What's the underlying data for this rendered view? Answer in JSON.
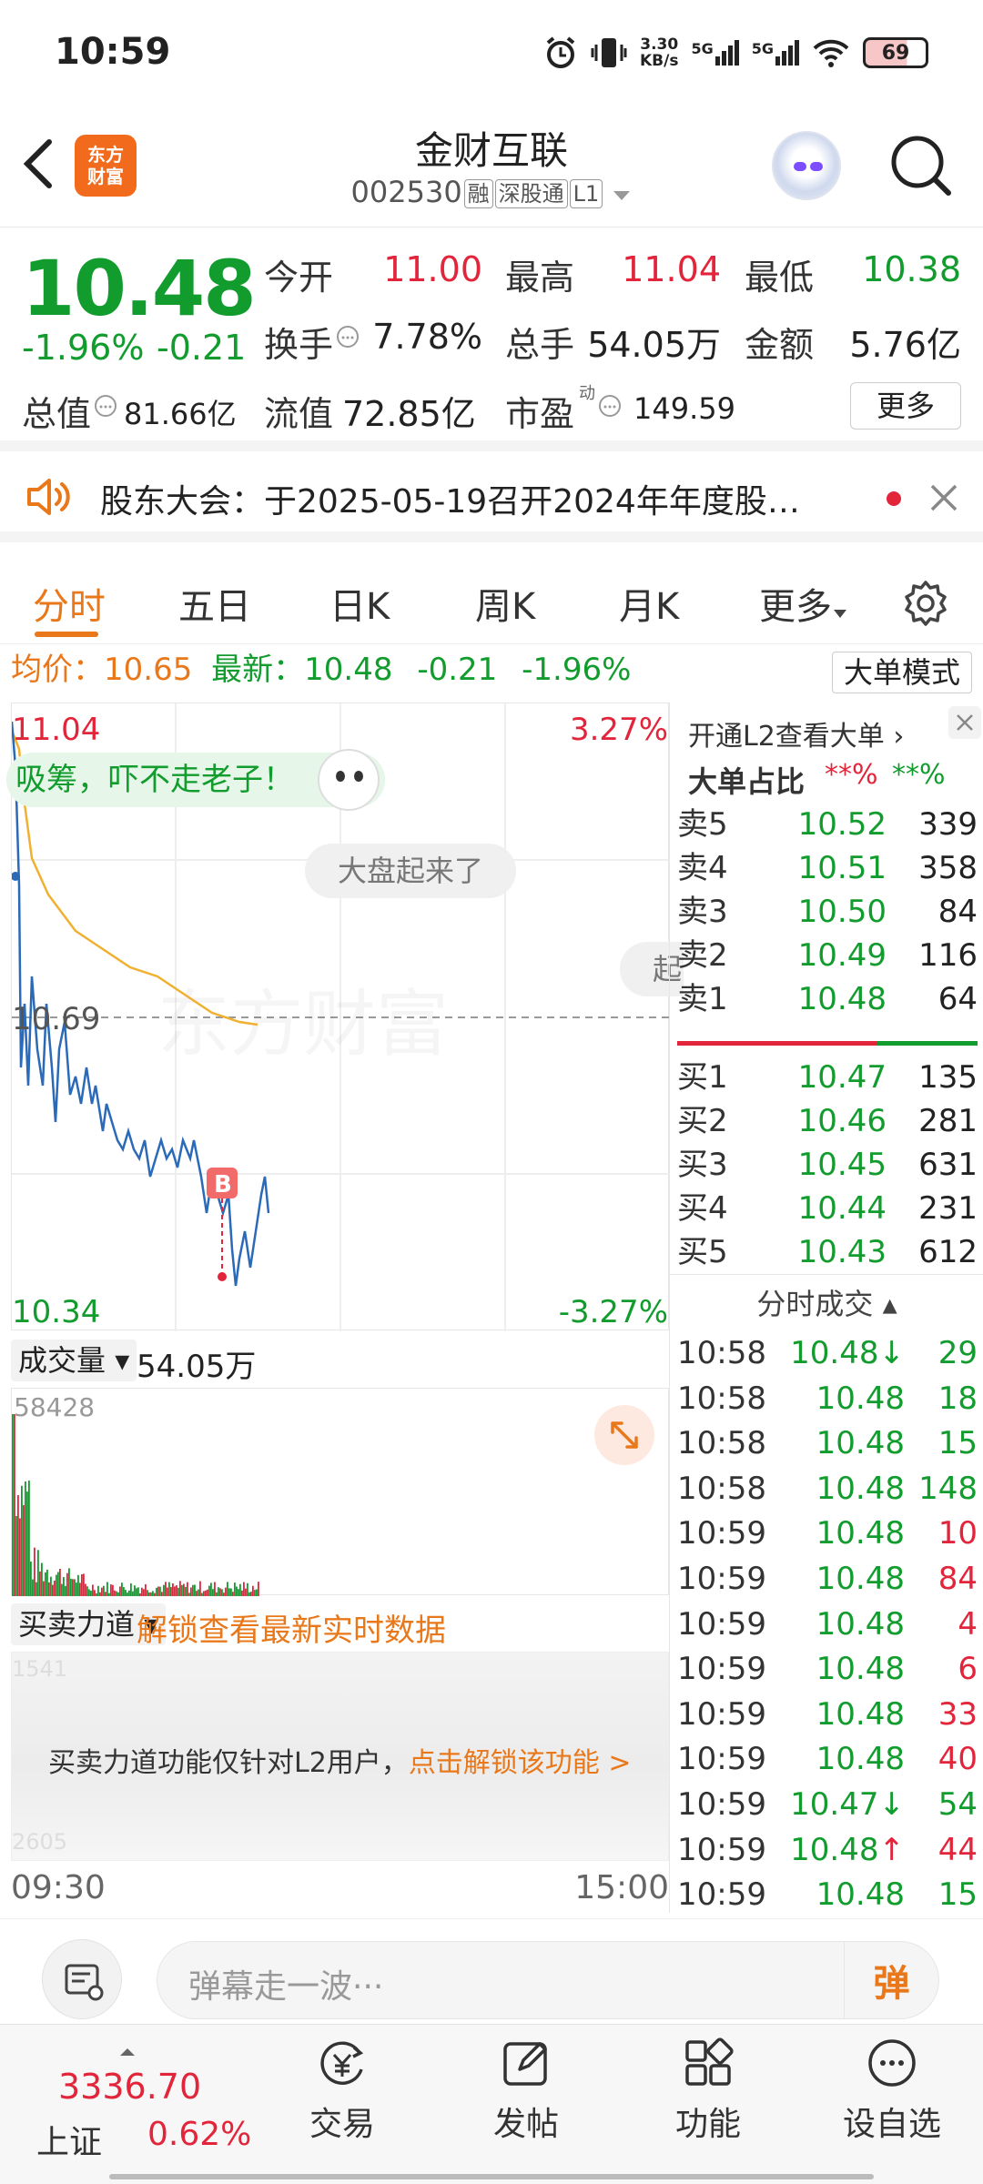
{
  "status_bar": {
    "time": "10:59",
    "net_speed_top": "3.30",
    "net_speed_unit": "KB/s",
    "sig1": "5G",
    "sig2": "5G",
    "battery": "69"
  },
  "header": {
    "logo_line1": "东方",
    "logo_line2": "财富",
    "stock_name": "金财互联",
    "code": "002530",
    "tag_margin": "融",
    "tag_connect": "深股通",
    "tag_level": "L1"
  },
  "quote": {
    "price": "10.48",
    "change_pct": "-1.96%",
    "change_val": "-0.21",
    "open_label": "今开",
    "open": "11.00",
    "high_label": "最高",
    "high": "11.04",
    "low_label": "最低",
    "low": "10.38",
    "turnover_label": "换手",
    "turnover": "7.78%",
    "volume_label": "总手",
    "volume": "54.05万",
    "amount_label": "金额",
    "amount": "5.76亿",
    "mktcap_label": "总值",
    "mktcap": "81.66亿",
    "float_label": "流值",
    "float_val": "72.85亿",
    "pe_label": "市盈",
    "pe_sup": "动",
    "pe": "149.59",
    "more_label": "更多"
  },
  "notice": {
    "text": "股东大会：于2025-05-19召开2024年年度股…"
  },
  "tabs": {
    "t1": "分时",
    "t2": "五日",
    "t3": "日K",
    "t4": "周K",
    "t5": "月K",
    "t6": "更多",
    "active": "分时"
  },
  "infobar": {
    "avg_label": "均价：",
    "avg": "10.65",
    "latest_label": "最新：",
    "latest": "10.48",
    "chg": "-0.21",
    "pct": "-1.96%",
    "big_order_mode": "大单模式"
  },
  "chart": {
    "top_price": "11.04",
    "top_pct": "3.27%",
    "mid_price": "10.69",
    "bottom_price": "10.34",
    "bottom_pct": "-3.27%",
    "bubble": "吸筹，吓不走老子！",
    "bubble2": "大盘起来了",
    "bubble3": "起",
    "watermark": "东方财富",
    "buy_marker": "B"
  },
  "volume": {
    "selector": "成交量",
    "total": "54.05万",
    "max": "58428"
  },
  "mm": {
    "selector": "买卖力道",
    "unlock": "解锁查看最新实时数据",
    "msg": "买卖力道功能仅针对L2用户，",
    "link": "点击解锁该功能 >",
    "faint1": "1541",
    "faint2": "2605"
  },
  "axis": {
    "start": "09:30",
    "end": "15:00"
  },
  "l2": {
    "open_link": "开通L2查看大单",
    "ratio_label": "大单占比",
    "ratio_red": "**%",
    "ratio_green": "**%",
    "asks": [
      {
        "label": "卖5",
        "price": "10.52",
        "vol": "339"
      },
      {
        "label": "卖4",
        "price": "10.51",
        "vol": "358"
      },
      {
        "label": "卖3",
        "price": "10.50",
        "vol": "84"
      },
      {
        "label": "卖2",
        "price": "10.49",
        "vol": "116"
      },
      {
        "label": "卖1",
        "price": "10.48",
        "vol": "64"
      }
    ],
    "bids": [
      {
        "label": "买1",
        "price": "10.47",
        "vol": "135"
      },
      {
        "label": "买2",
        "price": "10.46",
        "vol": "281"
      },
      {
        "label": "买3",
        "price": "10.45",
        "vol": "631"
      },
      {
        "label": "买4",
        "price": "10.44",
        "vol": "231"
      },
      {
        "label": "买5",
        "price": "10.43",
        "vol": "612"
      }
    ],
    "ticks_title": "分时成交",
    "ticks": [
      {
        "t": "10:58",
        "p": "10.48↓",
        "v": "29",
        "dir": "s"
      },
      {
        "t": "10:58",
        "p": "10.48",
        "v": "18",
        "dir": "s"
      },
      {
        "t": "10:58",
        "p": "10.48",
        "v": "15",
        "dir": "s"
      },
      {
        "t": "10:58",
        "p": "10.48",
        "v": "148",
        "dir": "s"
      },
      {
        "t": "10:59",
        "p": "10.48",
        "v": "10",
        "dir": "b"
      },
      {
        "t": "10:59",
        "p": "10.48",
        "v": "84",
        "dir": "b"
      },
      {
        "t": "10:59",
        "p": "10.48",
        "v": "4",
        "dir": "b"
      },
      {
        "t": "10:59",
        "p": "10.48",
        "v": "6",
        "dir": "b"
      },
      {
        "t": "10:59",
        "p": "10.48",
        "v": "33",
        "dir": "b"
      },
      {
        "t": "10:59",
        "p": "10.48",
        "v": "40",
        "dir": "b"
      },
      {
        "t": "10:59",
        "p": "10.47↓",
        "v": "54",
        "dir": "s"
      },
      {
        "t": "10:59",
        "p": "10.48↑",
        "v": "44",
        "dir": "b"
      },
      {
        "t": "10:59",
        "p": "10.48",
        "v": "15",
        "dir": "s"
      }
    ]
  },
  "input": {
    "placeholder": "弹幕走一波···",
    "danmu_btn": "弹"
  },
  "bottom": {
    "index_value": "3336.70",
    "index_name": "上证",
    "index_pct": "0.62%",
    "trade": "交易",
    "post": "发帖",
    "func": "功能",
    "watch": "设自选"
  },
  "colors": {
    "red": "#e2253a",
    "green": "#129c2e",
    "orange": "#e9781b",
    "price_line": "#2a6ab8",
    "avg_line": "#f0b030"
  }
}
